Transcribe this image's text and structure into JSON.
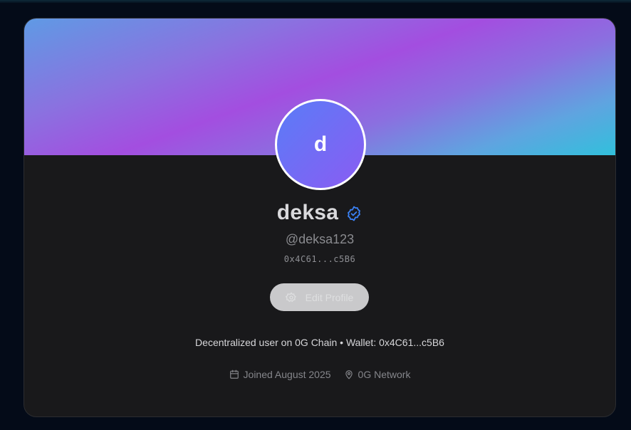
{
  "profile": {
    "avatar_initial": "d",
    "display_name": "deksa",
    "handle": "@deksa123",
    "wallet_short": "0x4C61...c5B6",
    "edit_button_label": "Edit Profile",
    "bio": "Decentralized user on 0G Chain • Wallet: 0x4C61...c5B6",
    "joined": "Joined August 2025",
    "location": "0G Network"
  },
  "icons": {
    "verified": "verified-badge-icon",
    "edit": "gear-icon",
    "joined": "calendar-icon",
    "location": "map-pin-icon"
  },
  "colors": {
    "accent": "#3b82f6",
    "card_bg": "#19191b",
    "page_bg": "#040b18",
    "avatar_gradient_start": "#5a7cf7",
    "avatar_gradient_end": "#8a5cf2"
  }
}
